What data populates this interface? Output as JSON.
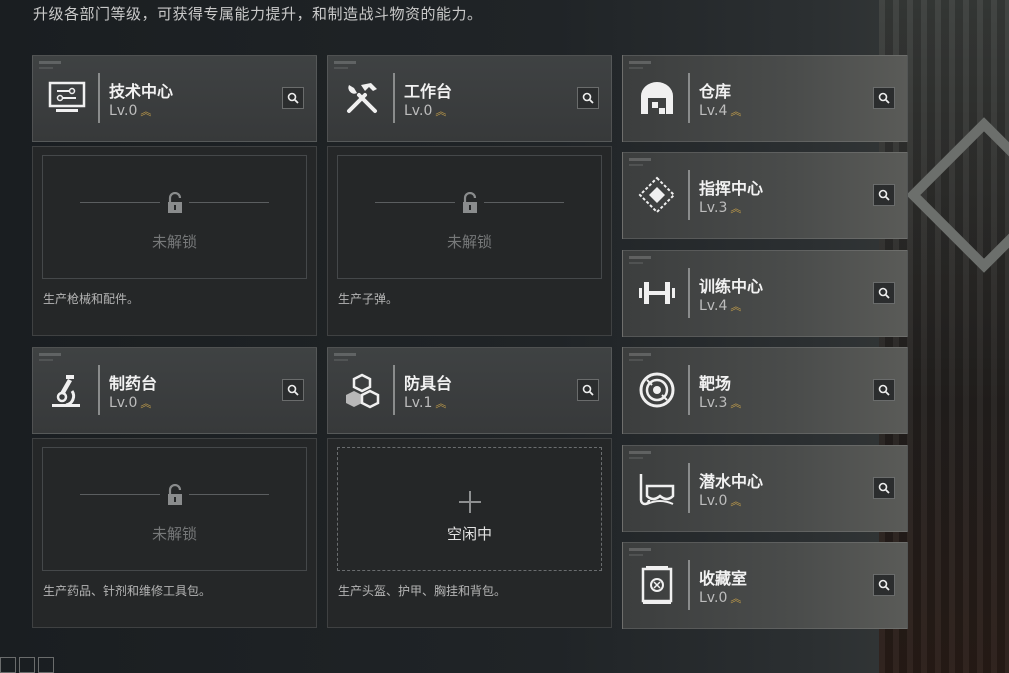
{
  "header": {
    "subtitle": "升级各部门等级，可获得专属能力提升，和制造战斗物资的能力。"
  },
  "facilities": [
    {
      "name": "技术中心",
      "level": "Lv.0",
      "icon": "monitor-icon",
      "status": "未解锁",
      "description": "生产枪械和配件。"
    },
    {
      "name": "工作台",
      "level": "Lv.0",
      "icon": "tools-icon",
      "status": "未解锁",
      "description": "生产子弹。"
    },
    {
      "name": "仓库",
      "level": "Lv.4",
      "icon": "warehouse-icon"
    },
    {
      "name": "指挥中心",
      "level": "Lv.3",
      "icon": "command-icon"
    },
    {
      "name": "训练中心",
      "level": "Lv.4",
      "icon": "dumbbell-icon"
    },
    {
      "name": "制药台",
      "level": "Lv.0",
      "icon": "microscope-icon",
      "status": "未解锁",
      "description": "生产药品、针剂和维修工具包。"
    },
    {
      "name": "防具台",
      "level": "Lv.1",
      "icon": "armor-cubes-icon",
      "status": "空闲中",
      "description": "生产头盔、护甲、胸挂和背包。"
    },
    {
      "name": "靶场",
      "level": "Lv.3",
      "icon": "target-icon"
    },
    {
      "name": "潜水中心",
      "level": "Lv.0",
      "icon": "diving-mask-icon"
    },
    {
      "name": "收藏室",
      "level": "Lv.0",
      "icon": "collection-icon"
    }
  ],
  "colors": {
    "accent_gold": "#c9a24a",
    "panel": "#3d4041",
    "panel_body": "#252728"
  }
}
